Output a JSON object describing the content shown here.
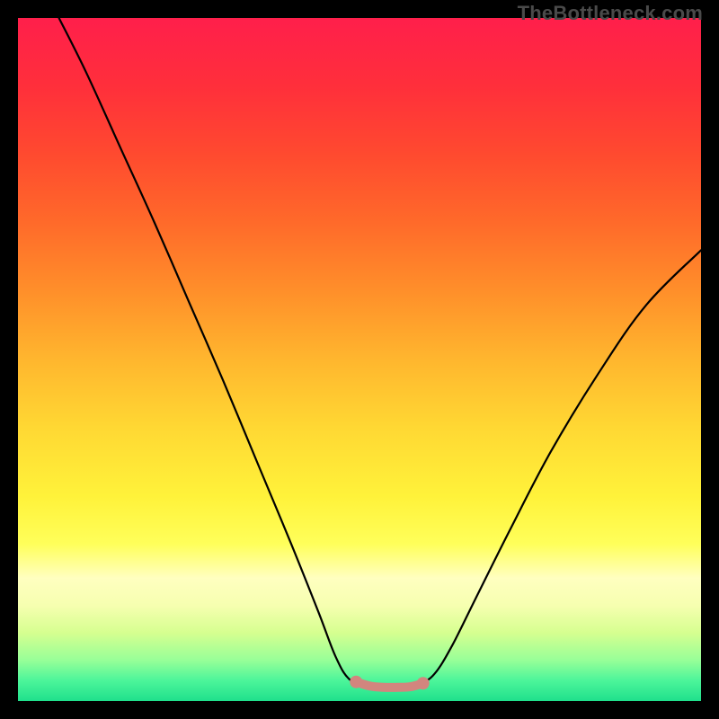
{
  "watermark": "TheBottleneck.com",
  "gradient": {
    "stops": [
      {
        "offset": 0.0,
        "color": "#ff1f4b"
      },
      {
        "offset": 0.1,
        "color": "#ff2f3b"
      },
      {
        "offset": 0.2,
        "color": "#ff4a2f"
      },
      {
        "offset": 0.3,
        "color": "#ff6a2a"
      },
      {
        "offset": 0.4,
        "color": "#ff8f2a"
      },
      {
        "offset": 0.5,
        "color": "#ffb62e"
      },
      {
        "offset": 0.6,
        "color": "#ffd833"
      },
      {
        "offset": 0.7,
        "color": "#fff23a"
      },
      {
        "offset": 0.77,
        "color": "#ffff5a"
      },
      {
        "offset": 0.82,
        "color": "#ffffc0"
      },
      {
        "offset": 0.86,
        "color": "#f6ffb0"
      },
      {
        "offset": 0.9,
        "color": "#d6ff90"
      },
      {
        "offset": 0.94,
        "color": "#98ff98"
      },
      {
        "offset": 0.97,
        "color": "#4cf59a"
      },
      {
        "offset": 1.0,
        "color": "#1fe08c"
      }
    ]
  },
  "chart_data": {
    "type": "line",
    "title": "",
    "xlabel": "",
    "ylabel": "",
    "xlim": [
      0,
      100
    ],
    "ylim": [
      0,
      100
    ],
    "series": [
      {
        "name": "curve",
        "stroke": "#000000",
        "stroke_width": 2.2,
        "points": [
          {
            "x": 6.0,
            "y": 100.0
          },
          {
            "x": 10.0,
            "y": 92.0
          },
          {
            "x": 15.0,
            "y": 81.0
          },
          {
            "x": 20.0,
            "y": 70.0
          },
          {
            "x": 25.0,
            "y": 58.5
          },
          {
            "x": 30.0,
            "y": 47.0
          },
          {
            "x": 35.0,
            "y": 35.0
          },
          {
            "x": 40.0,
            "y": 23.0
          },
          {
            "x": 44.0,
            "y": 13.0
          },
          {
            "x": 46.5,
            "y": 6.5
          },
          {
            "x": 48.5,
            "y": 3.2
          },
          {
            "x": 51.0,
            "y": 2.2
          },
          {
            "x": 53.0,
            "y": 2.0
          },
          {
            "x": 55.0,
            "y": 2.0
          },
          {
            "x": 57.0,
            "y": 2.1
          },
          {
            "x": 59.0,
            "y": 2.6
          },
          {
            "x": 61.0,
            "y": 4.0
          },
          {
            "x": 63.5,
            "y": 8.0
          },
          {
            "x": 67.0,
            "y": 15.0
          },
          {
            "x": 72.0,
            "y": 25.0
          },
          {
            "x": 78.0,
            "y": 36.5
          },
          {
            "x": 85.0,
            "y": 48.0
          },
          {
            "x": 92.0,
            "y": 58.0
          },
          {
            "x": 100.0,
            "y": 66.0
          }
        ]
      },
      {
        "name": "highlight-segment",
        "stroke": "#d2857e",
        "stroke_width": 10,
        "endpoints_radius": 7,
        "points": [
          {
            "x": 49.5,
            "y": 2.8
          },
          {
            "x": 51.5,
            "y": 2.2
          },
          {
            "x": 53.5,
            "y": 2.0
          },
          {
            "x": 55.5,
            "y": 2.0
          },
          {
            "x": 57.5,
            "y": 2.1
          },
          {
            "x": 59.3,
            "y": 2.6
          }
        ]
      }
    ]
  }
}
